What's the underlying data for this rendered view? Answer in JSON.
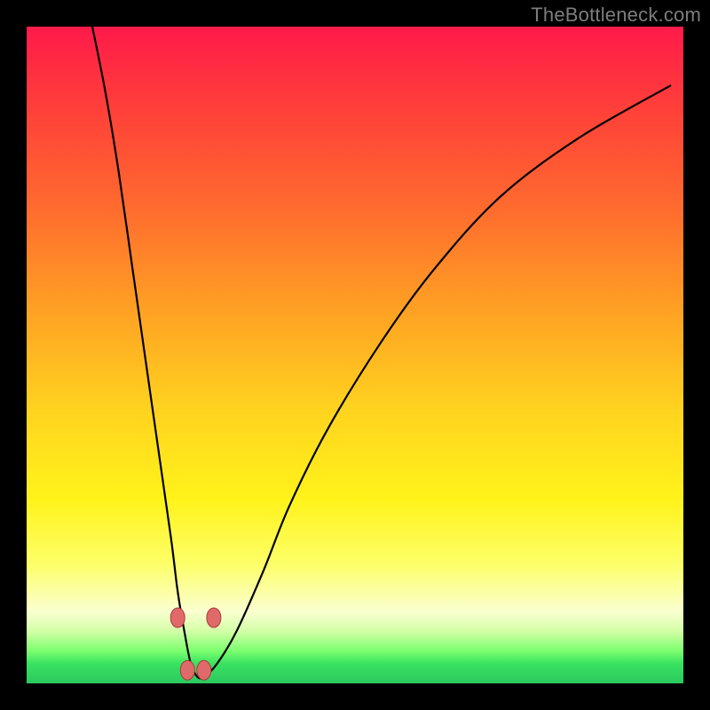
{
  "watermark": "TheBottleneck.com",
  "colors": {
    "gradient_top": "#ff1a4a",
    "gradient_mid": "#ffd21f",
    "gradient_bottom": "#2bc85f",
    "curve_stroke": "#000000",
    "marker_fill": "#e06a6a",
    "marker_stroke": "#a83a3a",
    "frame": "#000000"
  },
  "chart_data": {
    "type": "line",
    "title": "",
    "xlabel": "",
    "ylabel": "",
    "xlim": [
      0,
      100
    ],
    "ylim": [
      0,
      100
    ],
    "series": [
      {
        "name": "bottleneck-curve",
        "x": [
          10,
          12,
          14,
          16,
          18,
          20,
          22,
          23,
          24,
          25,
          26,
          27,
          29,
          32,
          36,
          40,
          46,
          54,
          62,
          72,
          84,
          98
        ],
        "values": [
          100,
          90,
          78,
          64,
          50,
          36,
          22,
          14,
          8,
          3,
          1,
          1,
          3,
          8,
          17,
          27,
          39,
          52,
          63,
          74,
          83,
          91
        ]
      }
    ],
    "markers": [
      {
        "x": 23.0,
        "y": 10,
        "label": "left-upper-dot"
      },
      {
        "x": 24.5,
        "y": 2,
        "label": "left-lower-dot"
      },
      {
        "x": 27.0,
        "y": 2,
        "label": "right-lower-dot"
      },
      {
        "x": 28.5,
        "y": 10,
        "label": "right-upper-dot"
      }
    ],
    "notes": "Axis ticks and numeric labels are not rendered in the source image; values are estimated on a 0–100 normalized scale from pixel positions."
  }
}
